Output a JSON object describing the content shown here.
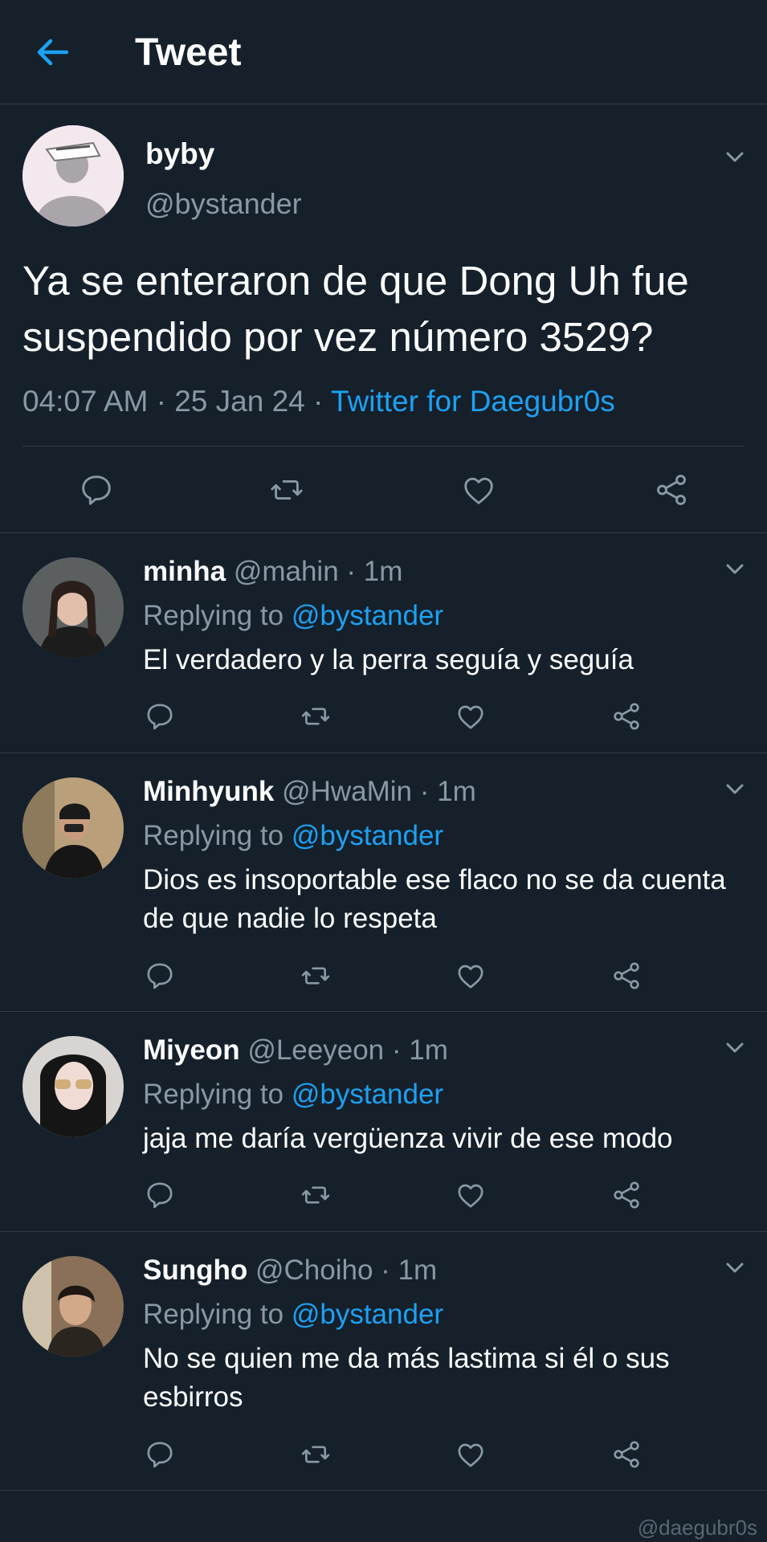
{
  "header": {
    "title": "Tweet",
    "back_icon": "arrow-left-icon",
    "accent": "#1da1f2"
  },
  "tweet": {
    "name": "byby",
    "handle": "@bystander",
    "text": "Ya se enteraron de que Dong Uh fue suspendido por vez número 3529?",
    "time": "04:07 AM",
    "date": "25 Jan 24",
    "source": "Twitter for Daegubr0s"
  },
  "replies": [
    {
      "name": "minha",
      "handle": "@mahin",
      "time": "1m",
      "replying_prefix": "Replying to",
      "replying_to": "@bystander",
      "text": "El verdadero y la perra seguía y seguía"
    },
    {
      "name": "Minhyunk",
      "handle": "@HwaMin",
      "time": "1m",
      "replying_prefix": "Replying to",
      "replying_to": "@bystander",
      "text": "Dios es insoportable ese flaco no se da cuenta de que nadie lo respeta"
    },
    {
      "name": "Miyeon",
      "handle": "@Leeyeon",
      "time": "1m",
      "replying_prefix": "Replying to",
      "replying_to": "@bystander",
      "text": "jaja me daría vergüenza vivir de ese modo"
    },
    {
      "name": "Sungho",
      "handle": "@Choiho",
      "time": "1m",
      "replying_prefix": "Replying to",
      "replying_to": "@bystander",
      "text": "No se quien me da más lastima si él o sus esbirros"
    }
  ],
  "separator": "·",
  "watermark": "@daegubr0s"
}
